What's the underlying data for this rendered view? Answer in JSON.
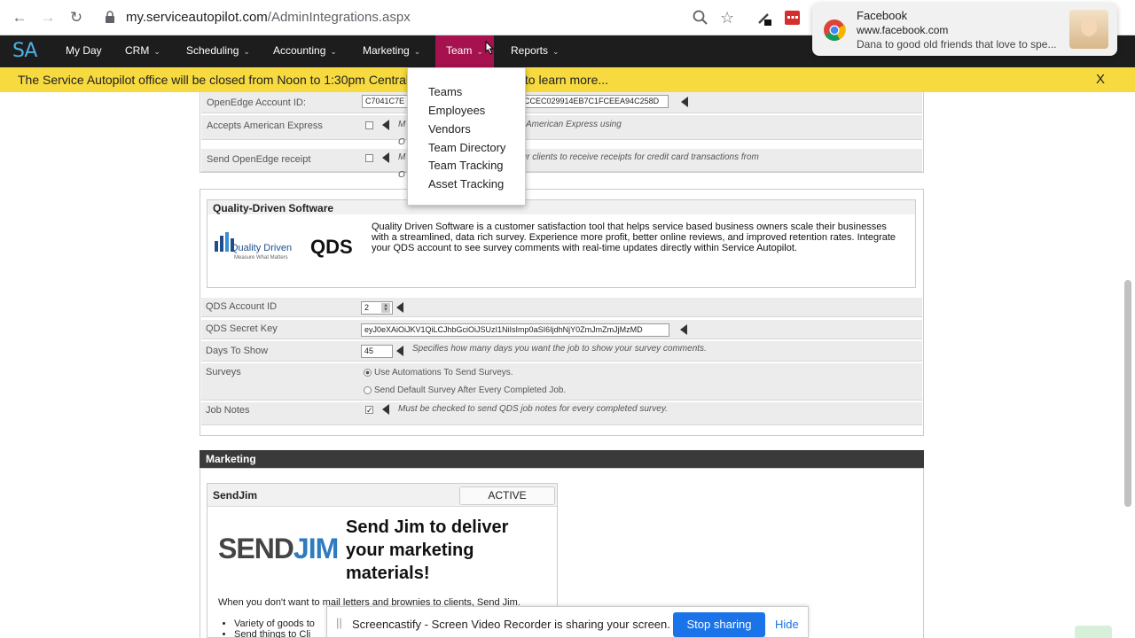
{
  "browser": {
    "url_host": "my.serviceautopilot.com",
    "url_path": "/AdminIntegrations.aspx"
  },
  "nav": {
    "logo": "SA",
    "items": [
      {
        "label": "My Day"
      },
      {
        "label": "CRM"
      },
      {
        "label": "Scheduling"
      },
      {
        "label": "Accounting"
      },
      {
        "label": "Marketing"
      },
      {
        "label": "Team"
      },
      {
        "label": "Reports"
      }
    ]
  },
  "banner": {
    "text": "The Service Autopilot office will be closed from Noon to 1:30pm Central time c",
    "text_tail": "ck to learn more...",
    "close": "X"
  },
  "team_menu": {
    "items": [
      "Teams",
      "Employees",
      "Vendors",
      "Team Directory",
      "Team Tracking",
      "Asset Tracking"
    ]
  },
  "openedge": {
    "account_label": "OpenEdge Account ID:",
    "account_value_left": "C7041C7E",
    "account_value_right": "CCEC029914EB7C1FCEEA94C258D",
    "amex_label": "Accepts American Express",
    "amex_hint_a": "M",
    "amex_hint_b": "American Express using",
    "amex_hint_c": "O",
    "receipt_label": "Send OpenEdge receipt",
    "receipt_hint_a": "M",
    "receipt_hint_b": "our clients to receive receipts for credit card transactions from",
    "receipt_hint_c": "O"
  },
  "qds": {
    "title": "Quality-Driven Software",
    "logo_text": "Quality Driven",
    "logo_tagline": "Measure What Matters",
    "logo_abbr": "QDS",
    "description": "Quality Driven Software is a customer satisfaction tool that helps service based business owners scale their businesses with a streamlined, data rich survey. Experience more profit, better online reviews, and improved retention rates. Integrate your QDS account to see survey comments with real-time updates directly within Service Autopilot.",
    "account_id_label": "QDS Account ID",
    "account_id_value": "2",
    "secret_key_label": "QDS Secret Key",
    "secret_key_value": "eyJ0eXAiOiJKV1QiLCJhbGciOiJSUzI1NiIsImp0aSI6IjdhNjY0ZmJmZmJjMzMD",
    "days_label": "Days To Show",
    "days_value": "45",
    "days_hint": "Specifies how many days you want the job to show your survey comments.",
    "surveys_label": "Surveys",
    "survey_option_1": "Use Automations To Send Surveys.",
    "survey_option_2": "Send Default Survey After Every Completed Job.",
    "job_notes_label": "Job Notes",
    "job_notes_hint": "Must be checked to send QDS job notes for every completed survey."
  },
  "marketing": {
    "section_title": "Marketing",
    "sendjim_title": "SendJim",
    "sendjim_status": "ACTIVE",
    "sendjim_logo_a": "SEND",
    "sendjim_logo_b": "JIM",
    "headline": "Send Jim to deliver your marketing materials!",
    "body": "When you don't want to mail letters and brownies to clients, Send Jim.",
    "bullet_1": "Variety of goods to",
    "bullet_2": "Send things to Cli"
  },
  "notification": {
    "title": "Facebook",
    "site": "www.facebook.com",
    "message": "Dana to good old friends that love to spe..."
  },
  "screenshare": {
    "message": "Screencastify - Screen Video Recorder is sharing your screen.",
    "stop": "Stop sharing",
    "hide": "Hide"
  },
  "colors": {
    "nav_bg": "#1d1d1d",
    "active_tab": "#a5124d",
    "banner": "#f6da3f",
    "stop_button": "#1a73e8",
    "logo": "#4fb1e3"
  }
}
